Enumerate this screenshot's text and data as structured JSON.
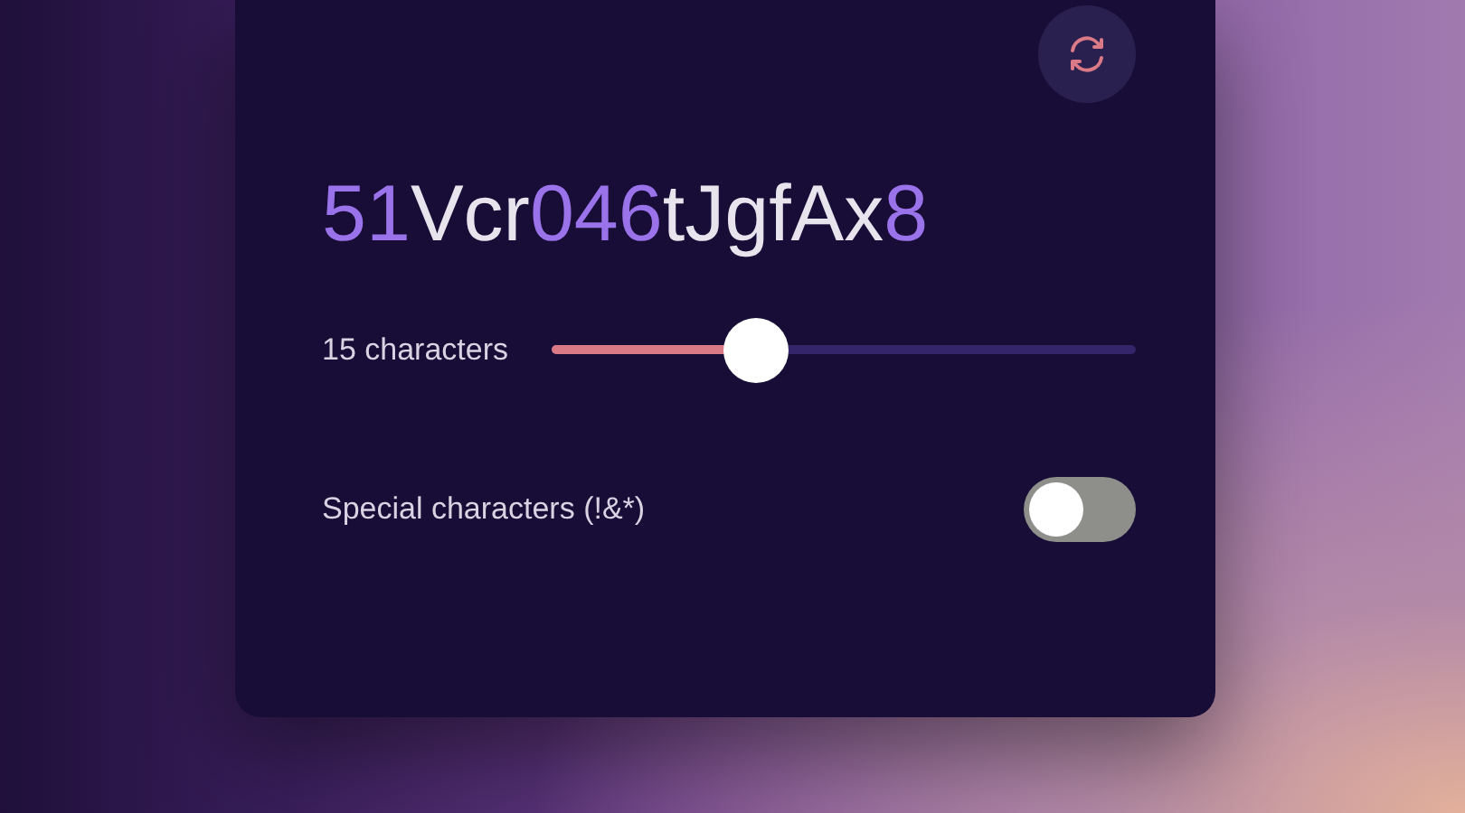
{
  "password": {
    "segments": [
      {
        "text": "51",
        "kind": "digit"
      },
      {
        "text": "Vcr",
        "kind": "letter"
      },
      {
        "text": "046",
        "kind": "digit"
      },
      {
        "text": "tJgfAx",
        "kind": "letter"
      },
      {
        "text": "8",
        "kind": "digit"
      }
    ]
  },
  "length": {
    "label": "15 characters",
    "level": 0.35
  },
  "special": {
    "label": "Special characters (!&*)",
    "on": false
  }
}
